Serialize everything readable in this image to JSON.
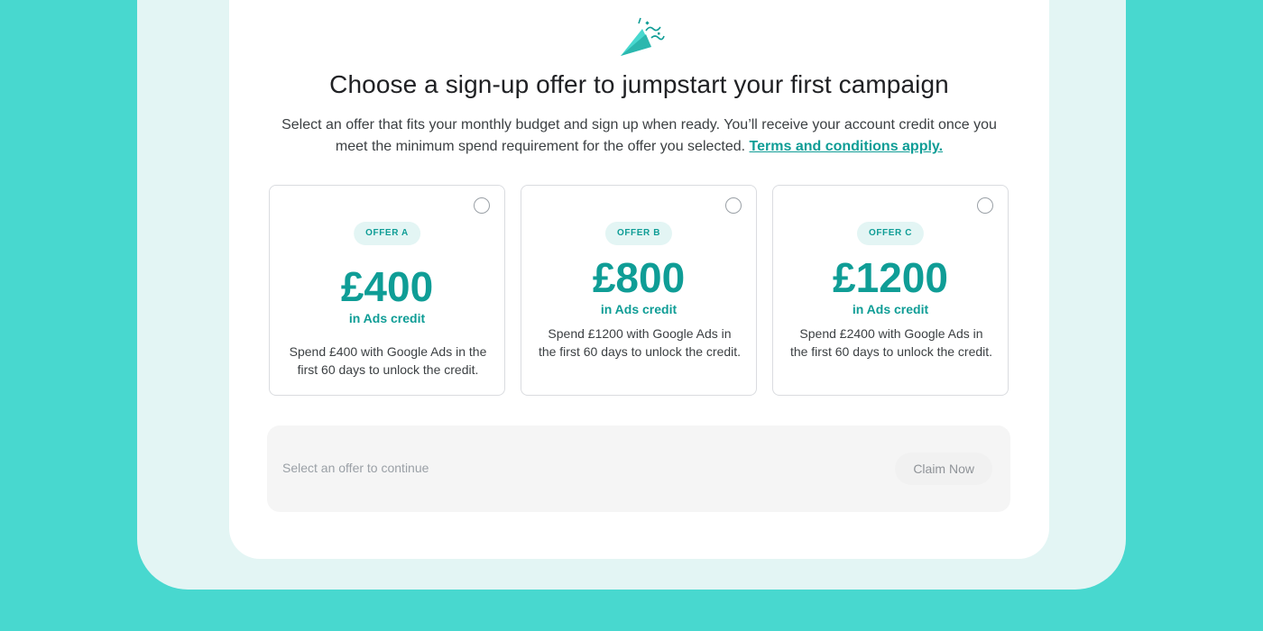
{
  "header": {
    "title": "Choose a sign-up offer to jumpstart your first campaign",
    "description": "Select an offer that fits your monthly budget and sign up when ready. You’ll receive your account credit once you meet the minimum spend requirement for the offer you selected.",
    "terms_link": "Terms and conditions apply.",
    "icon": "party-popper-icon"
  },
  "offers": [
    {
      "badge": "OFFER A",
      "amount": "£400",
      "credit_label": "in Ads credit",
      "requirement": "Spend £400 with Google Ads in the first 60 days to unlock the credit.",
      "selected": false
    },
    {
      "badge": "OFFER B",
      "amount": "£800",
      "credit_label": "in Ads credit",
      "requirement": "Spend £1200 with Google Ads in the first 60 days to unlock the credit.",
      "selected": false
    },
    {
      "badge": "OFFER C",
      "amount": "£1200",
      "credit_label": "in Ads credit",
      "requirement": "Spend £2400 with Google Ads in the first 60 days to unlock the credit.",
      "selected": false
    }
  ],
  "footer": {
    "hint": "Select an offer to continue",
    "claim_label": "Claim Now"
  },
  "colors": {
    "accent": "#0f9d96",
    "background": "#48d8cf",
    "frame": "#e3f5f4",
    "panel": "#ffffff"
  }
}
